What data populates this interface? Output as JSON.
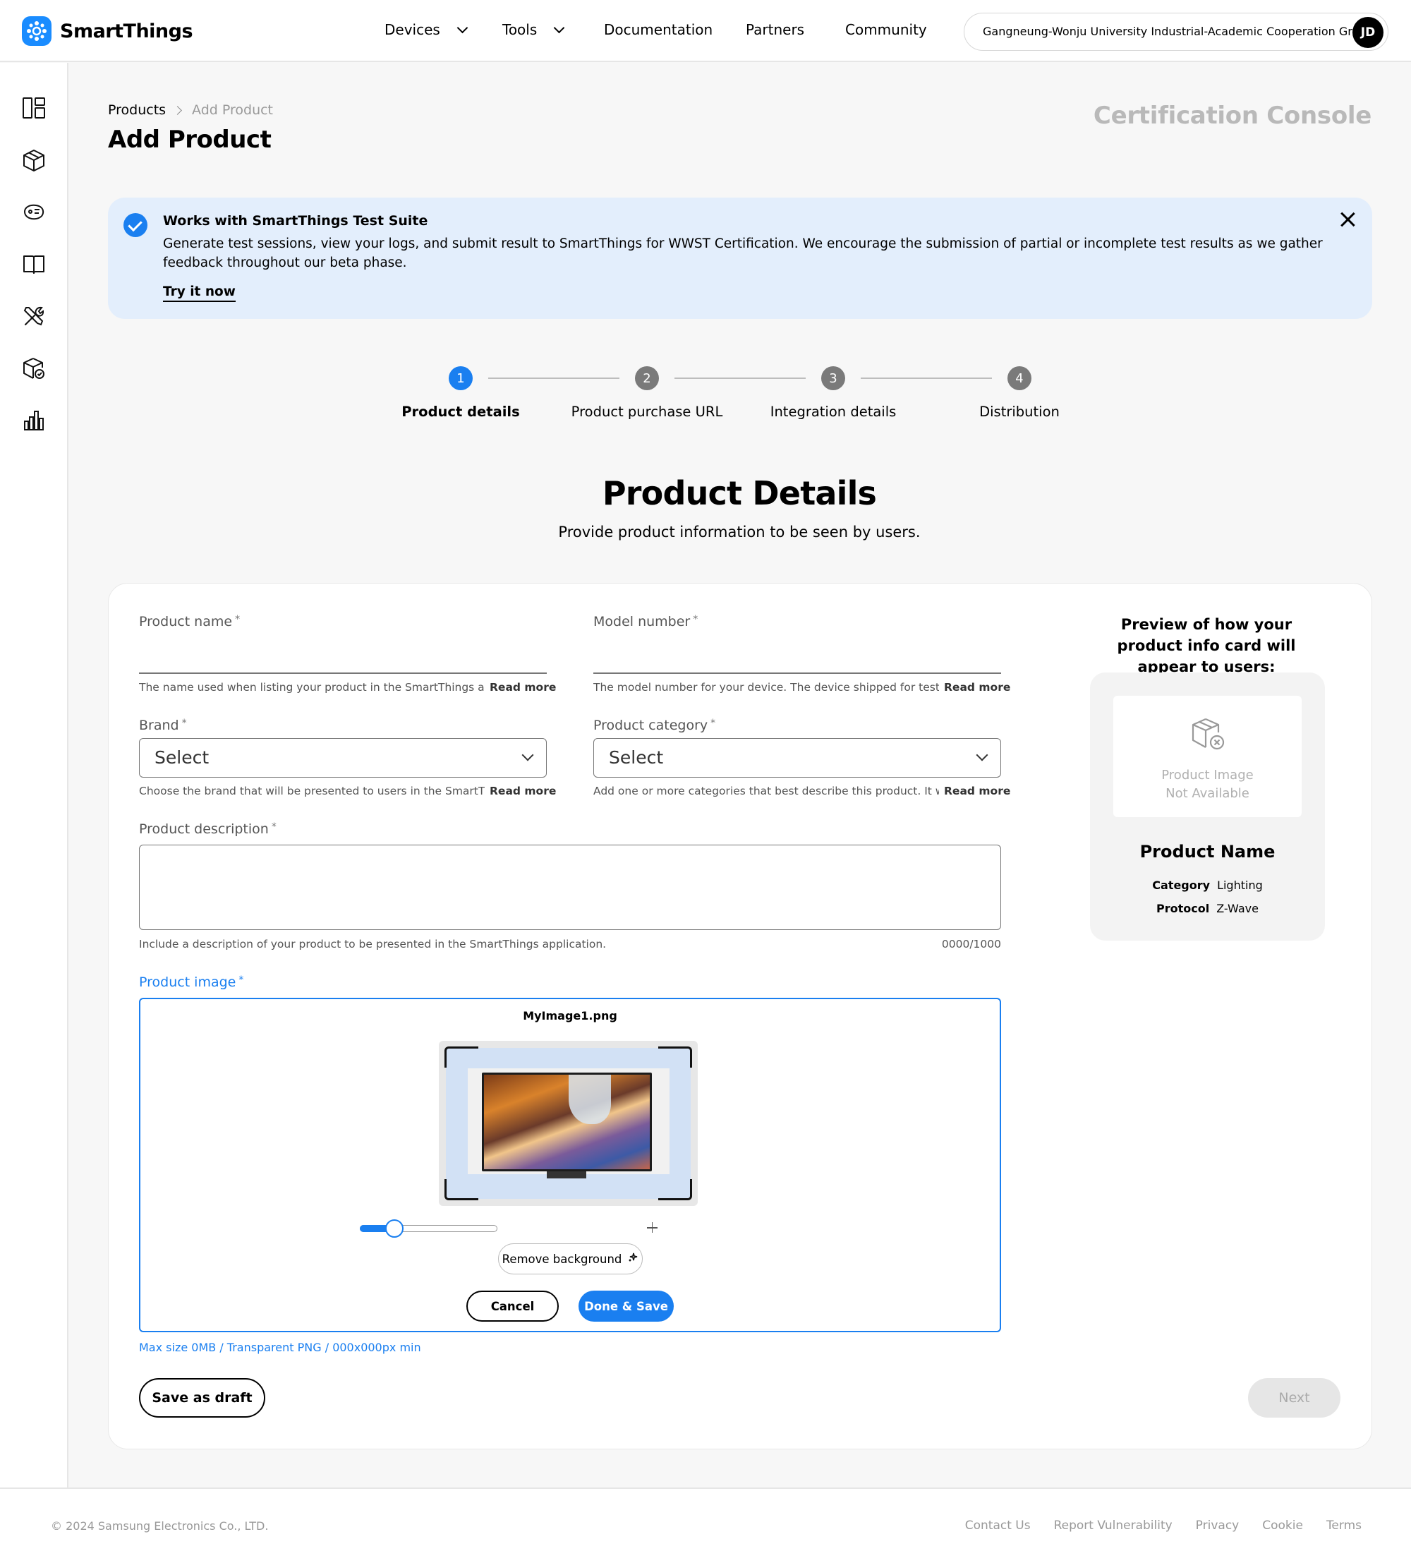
{
  "brand": {
    "name": "SmartThings",
    "accent": "#1a7ff0"
  },
  "nav": {
    "devices": "Devices",
    "tools": "Tools",
    "documentation": "Documentation",
    "partners": "Partners",
    "community": "Community"
  },
  "account": {
    "org": "Gangneung-Wonju University Industrial-Academic Cooperation Group",
    "initials": "JD"
  },
  "sidebar": {
    "icons": [
      "dashboard-icon",
      "box-icon",
      "device-icon",
      "book-icon",
      "tools-icon",
      "certified-box-icon",
      "analytics-icon"
    ]
  },
  "breadcrumb": {
    "root": "Products",
    "current": "Add Product"
  },
  "page": {
    "title": "Add Product",
    "console": "Certification Console"
  },
  "banner": {
    "title": "Works with SmartThings Test Suite",
    "text": "Generate test sessions, view your logs, and submit result to SmartThings for WWST Certification. We encourage the submission of partial or incomplete test results as we gather feedback throughout our beta phase.",
    "link": "Try it now"
  },
  "stepper": {
    "steps": [
      {
        "num": "1",
        "label": "Product details"
      },
      {
        "num": "2",
        "label": "Product purchase URL"
      },
      {
        "num": "3",
        "label": "Integration details"
      },
      {
        "num": "4",
        "label": "Distribution"
      }
    ]
  },
  "section": {
    "title": "Product Details",
    "subtitle": "Provide product information to be seen by users."
  },
  "form": {
    "required_mark": "*",
    "read_more": "Read more",
    "product_name": {
      "label": "Product name",
      "helper": "The name used when listing your product in the SmartThings app..."
    },
    "model_number": {
      "label": "Model number",
      "helper": "The model number for your device. The device shipped for testing..."
    },
    "brand": {
      "label": "Brand",
      "value": "Select",
      "helper": "Choose the brand that will be presented to users in the SmartThi..."
    },
    "category": {
      "label": "Product category",
      "value": "Select",
      "helper": "Add one or more categories that best describe this product. It wil..."
    },
    "description": {
      "label": "Product description",
      "helper": "Include a description of your product to be presented in the SmartThings application.",
      "counter": "0000/1000"
    },
    "image": {
      "label": "Product image",
      "file_name": "MyImage1.png",
      "zoom_fraction": 0.25,
      "remove_bg": "Remove background",
      "cancel": "Cancel",
      "done": "Done & Save",
      "note": "Max size 0MB / Transparent PNG / 000x000px min"
    },
    "save_draft": "Save as draft",
    "next": "Next"
  },
  "preview": {
    "title": "Preview of how your product info card will appear to users:",
    "image_missing": "Product Image Not Available",
    "name": "Product Name",
    "category_label": "Category",
    "category_value": "Lighting",
    "protocol_label": "Protocol",
    "protocol_value": "Z-Wave"
  },
  "footer": {
    "copyright": "© 2024 Samsung Electronics Co., LTD.",
    "links": [
      "Contact Us",
      "Report Vulnerability",
      "Privacy",
      "Cookie",
      "Terms"
    ]
  }
}
